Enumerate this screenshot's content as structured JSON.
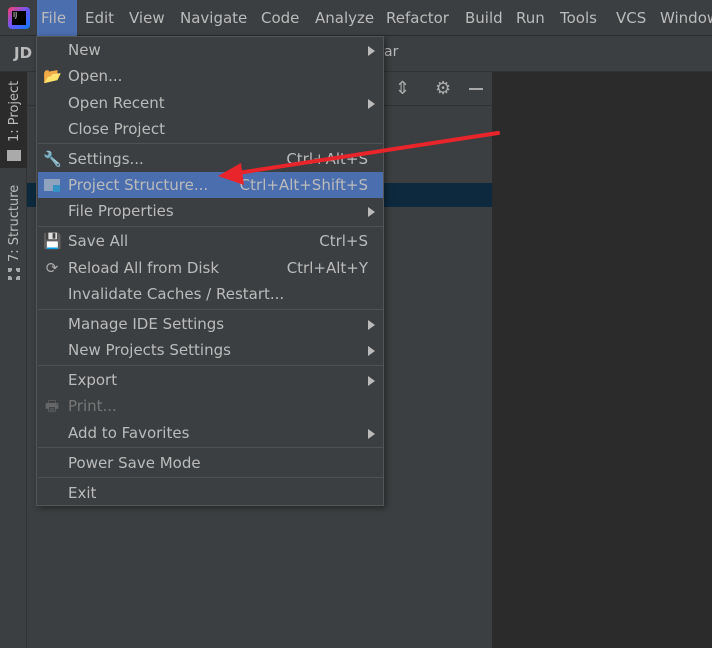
{
  "menubar": {
    "items": [
      "File",
      "Edit",
      "View",
      "Navigate",
      "Code",
      "Analyze",
      "Refactor",
      "Build",
      "Run",
      "Tools",
      "VCS",
      "Window"
    ],
    "active": "File"
  },
  "navbar": {
    "project": "JD",
    "trailing": "ar"
  },
  "toolstrip": {
    "project": "1: Project",
    "structure": "7: Structure"
  },
  "file_menu": {
    "items": [
      {
        "label": "New",
        "submenu": true
      },
      {
        "label": "Open...",
        "icon": "folder-open-icon"
      },
      {
        "label": "Open Recent",
        "submenu": true
      },
      {
        "label": "Close Project"
      },
      {
        "label": "Settings...",
        "shortcut": "Ctrl+Alt+S",
        "icon": "wrench-icon"
      },
      {
        "label": "Project Structure...",
        "shortcut": "Ctrl+Alt+Shift+S",
        "icon": "project-structure-icon",
        "highlighted": true
      },
      {
        "label": "File Properties",
        "submenu": true
      },
      {
        "label": "Save All",
        "shortcut": "Ctrl+S",
        "icon": "save-icon"
      },
      {
        "label": "Reload All from Disk",
        "shortcut": "Ctrl+Alt+Y",
        "icon": "reload-icon"
      },
      {
        "label": "Invalidate Caches / Restart..."
      },
      {
        "label": "Manage IDE Settings",
        "submenu": true
      },
      {
        "label": "New Projects Settings",
        "submenu": true
      },
      {
        "label": "Export",
        "submenu": true
      },
      {
        "label": "Print...",
        "icon": "print-icon",
        "disabled": true
      },
      {
        "label": "Add to Favorites",
        "submenu": true
      },
      {
        "label": "Power Save Mode"
      },
      {
        "label": "Exit"
      }
    ]
  },
  "colors": {
    "highlight": "#4b6eaf",
    "annotation_arrow": "#e8252b"
  }
}
